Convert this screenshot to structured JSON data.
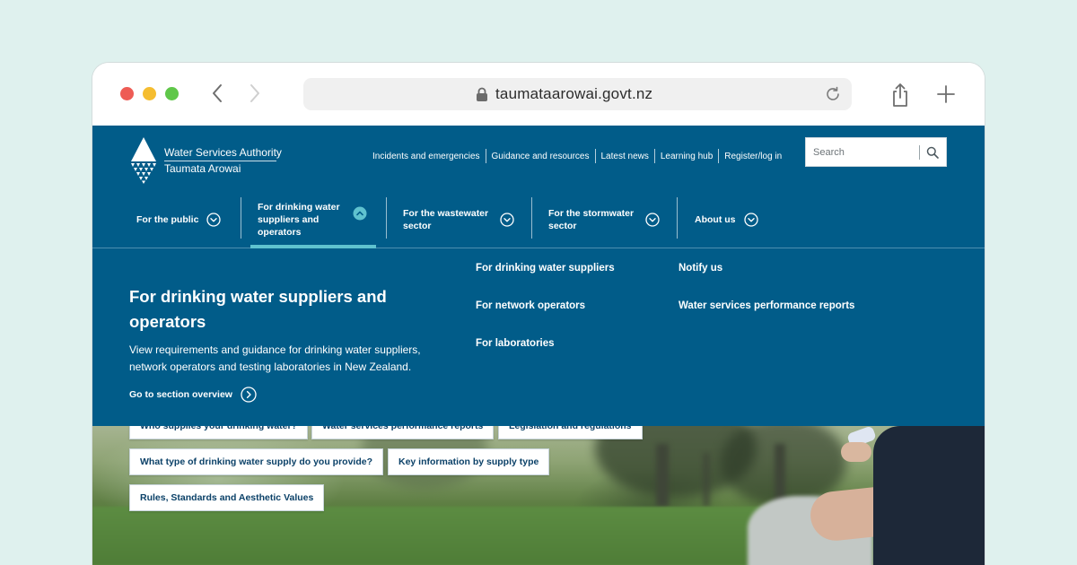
{
  "browser": {
    "url": "taumataarowai.govt.nz"
  },
  "brand": {
    "line1": "Water Services Authority",
    "line2": "Taumata Arowai"
  },
  "utility_nav": [
    {
      "label": "Incidents and emergencies"
    },
    {
      "label": "Guidance and resources"
    },
    {
      "label": "Latest news"
    },
    {
      "label": "Learning hub"
    },
    {
      "label": "Register/log in"
    }
  ],
  "search": {
    "placeholder": "Search"
  },
  "main_nav": [
    {
      "label": "For the public",
      "state": "collapsed"
    },
    {
      "label": "For drinking water suppliers and operators",
      "state": "expanded"
    },
    {
      "label": "For the wastewater sector",
      "state": "collapsed"
    },
    {
      "label": "For the stormwater sector",
      "state": "collapsed"
    },
    {
      "label": "About us",
      "state": "collapsed"
    }
  ],
  "mega_menu": {
    "title": "For drinking water suppliers and operators",
    "description": "View requirements and guidance for drinking water suppliers, network operators and testing laboratories in New Zealand.",
    "overview_link": "Go to section overview",
    "column1": [
      {
        "label": "For drinking water suppliers"
      },
      {
        "label": "For network operators"
      },
      {
        "label": "For laboratories"
      }
    ],
    "column2": [
      {
        "label": "Notify us"
      },
      {
        "label": "Water services performance reports"
      }
    ]
  },
  "quick_links": [
    {
      "label": "Who supplies your drinking water?"
    },
    {
      "label": "Water services performance reports"
    },
    {
      "label": "Legislation and regulations"
    },
    {
      "label": "What type of drinking water supply do you provide?"
    },
    {
      "label": "Key information by supply type"
    },
    {
      "label": "Rules, Standards and Aesthetic Values"
    }
  ],
  "colors": {
    "brand_blue": "#015c89",
    "accent_teal": "#5fc2cf",
    "chip_text": "#0b4168",
    "page_background": "#dff1ee"
  }
}
